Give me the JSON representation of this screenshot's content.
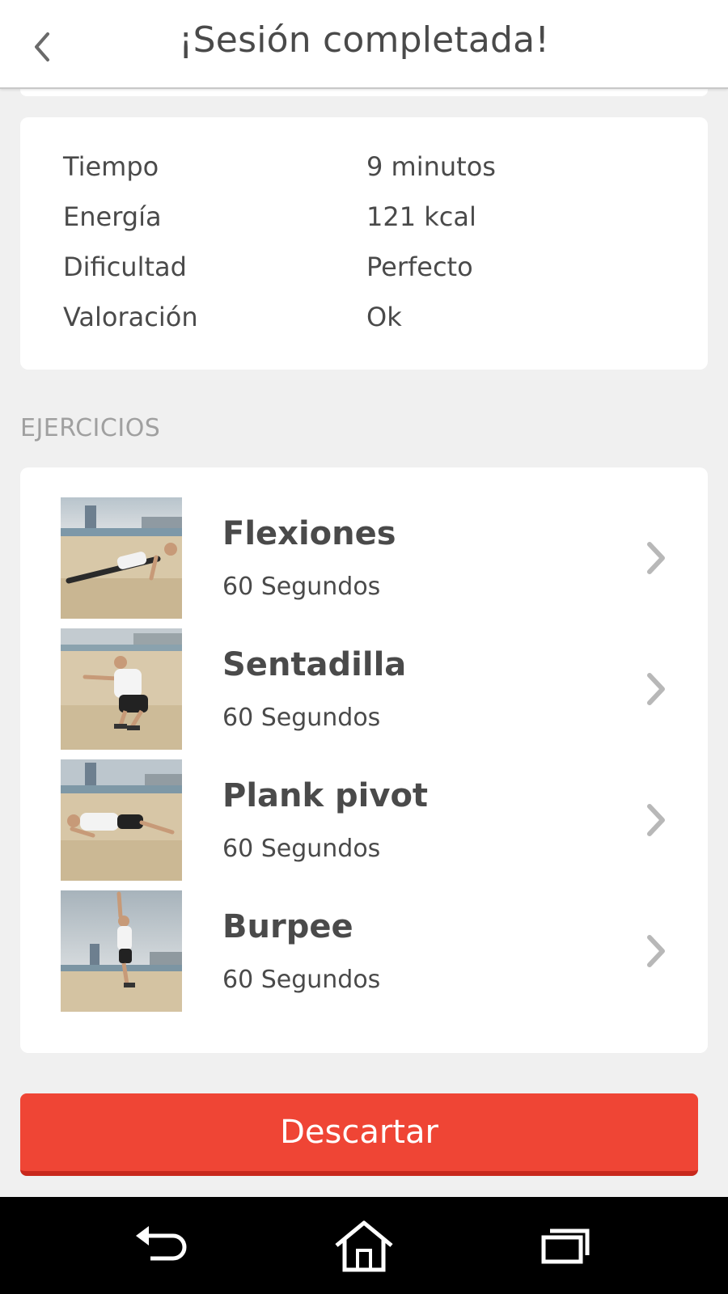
{
  "header": {
    "title": "¡Sesión completada!",
    "back_icon": "chevron-left-icon"
  },
  "stats": [
    {
      "label": "Tiempo",
      "value": "9 minutos"
    },
    {
      "label": "Energía",
      "value": "121 kcal"
    },
    {
      "label": "Dificultad",
      "value": "Perfecto"
    },
    {
      "label": "Valoración",
      "value": "Ok"
    }
  ],
  "section": {
    "exercises_label": "EJERCICIOS"
  },
  "exercises": [
    {
      "name": "Flexiones",
      "duration": "60 Segundos"
    },
    {
      "name": "Sentadilla",
      "duration": "60 Segundos"
    },
    {
      "name": "Plank pivot",
      "duration": "60 Segundos"
    },
    {
      "name": "Burpee",
      "duration": "60 Segundos"
    }
  ],
  "actions": {
    "discard_label": "Descartar"
  },
  "navbar": {
    "back_icon": "back-arrow-icon",
    "home_icon": "home-icon",
    "recents_icon": "recent-apps-icon"
  },
  "colors": {
    "accent": "#ef4535",
    "background": "#f0f0f0",
    "card": "#ffffff",
    "text": "#4a4a4a",
    "muted": "#a0a0a0"
  }
}
